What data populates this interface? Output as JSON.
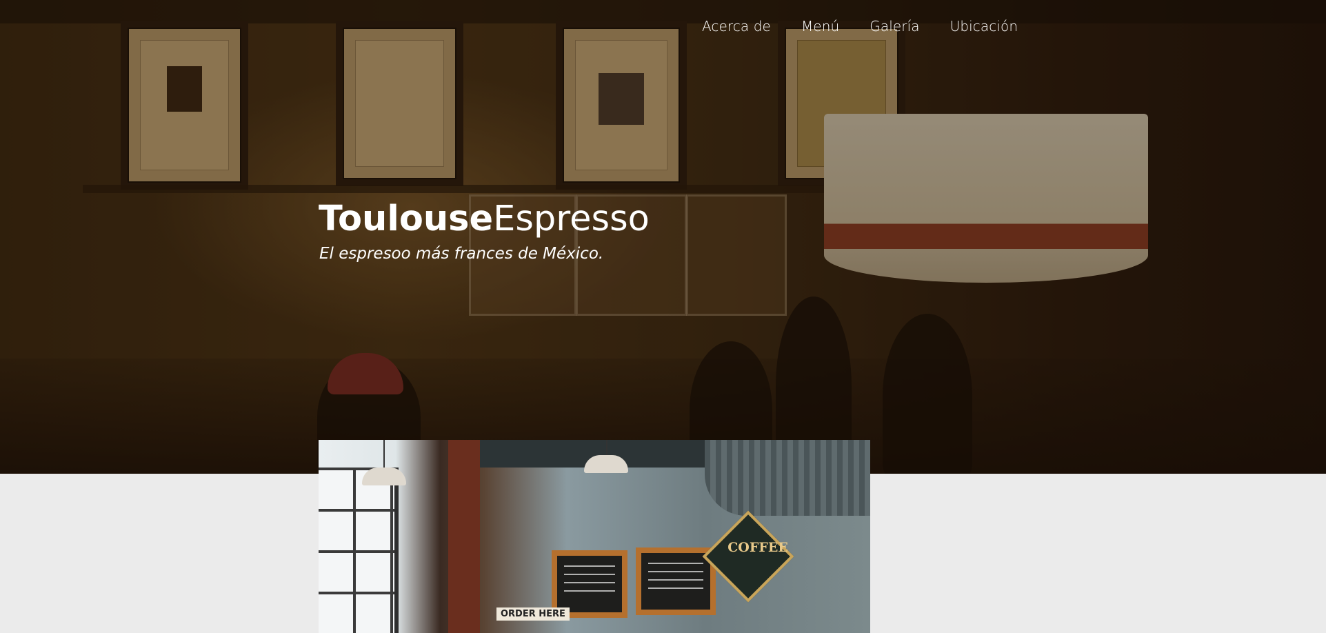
{
  "nav": {
    "items": [
      {
        "label": "Acerca de"
      },
      {
        "label": "Menú"
      },
      {
        "label": "Galería"
      },
      {
        "label": "Ubicación"
      }
    ]
  },
  "hero": {
    "brand_bold": "Toulouse",
    "brand_light": "Espresso",
    "tagline": "El espresoo más frances de México."
  },
  "photo": {
    "sign_text": "COFFEE",
    "order_text": "ORDER HERE"
  },
  "colors": {
    "nav_text": "#ffffff",
    "page_background": "#ebebeb"
  }
}
